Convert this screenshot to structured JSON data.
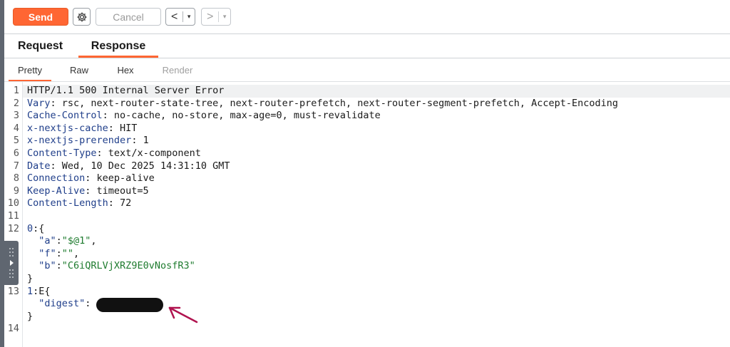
{
  "toolbar": {
    "send_label": "Send",
    "settings_icon": "gear-icon",
    "cancel_label": "Cancel",
    "back_label": "<",
    "back_dropdown": "▾",
    "forward_label": ">",
    "forward_dropdown": "▾"
  },
  "tabs": [
    {
      "label": "Request",
      "selected": false
    },
    {
      "label": "Response",
      "selected": true
    }
  ],
  "subtabs": [
    {
      "label": "Pretty",
      "selected": true
    },
    {
      "label": "Raw",
      "selected": false
    },
    {
      "label": "Hex",
      "selected": false
    },
    {
      "label": "Render",
      "selected": false,
      "disabled": true
    }
  ],
  "editor": {
    "lines": [
      {
        "num": "1",
        "segments": [
          [
            "HTTP/1.1 500 Internal Server Error",
            "v"
          ]
        ]
      },
      {
        "num": "2",
        "segments": [
          [
            "Vary",
            "k"
          ],
          [
            ": rsc, next-router-state-tree, next-router-prefetch, next-router-segment-prefetch, Accept-Encoding",
            "v"
          ]
        ]
      },
      {
        "num": "3",
        "segments": [
          [
            "Cache-Control",
            "k"
          ],
          [
            ": no-cache, no-store, max-age=0, must-revalidate",
            "v"
          ]
        ]
      },
      {
        "num": "4",
        "segments": [
          [
            "x-nextjs-cache",
            "k"
          ],
          [
            ": HIT",
            "v"
          ]
        ]
      },
      {
        "num": "5",
        "segments": [
          [
            "x-nextjs-prerender",
            "k"
          ],
          [
            ": 1",
            "v"
          ]
        ]
      },
      {
        "num": "6",
        "segments": [
          [
            "Content-Type",
            "k"
          ],
          [
            ": text/x-component",
            "v"
          ]
        ]
      },
      {
        "num": "7",
        "segments": [
          [
            "Date",
            "k"
          ],
          [
            ": Wed, 10 Dec 2025 14:31:10 GMT",
            "v"
          ]
        ]
      },
      {
        "num": "8",
        "segments": [
          [
            "Connection",
            "k"
          ],
          [
            ": keep-alive",
            "v"
          ]
        ]
      },
      {
        "num": "9",
        "segments": [
          [
            "Keep-Alive",
            "k"
          ],
          [
            ": timeout=5",
            "v"
          ]
        ]
      },
      {
        "num": "10",
        "segments": [
          [
            "Content-Length",
            "k"
          ],
          [
            ": 72",
            "v"
          ]
        ]
      },
      {
        "num": "11",
        "segments": []
      },
      {
        "num": "12",
        "segments": [
          [
            "0",
            "k"
          ],
          [
            ":{",
            "v"
          ]
        ]
      },
      {
        "num": "",
        "segments": [
          [
            "  \"a\"",
            "sq"
          ],
          [
            ":",
            "v"
          ],
          [
            "\"$@1\"",
            "s"
          ],
          [
            ",",
            "v"
          ]
        ]
      },
      {
        "num": "",
        "segments": [
          [
            "  \"f\"",
            "sq"
          ],
          [
            ":",
            "v"
          ],
          [
            "\"\"",
            "s"
          ],
          [
            ",",
            "v"
          ]
        ]
      },
      {
        "num": "",
        "segments": [
          [
            "  \"b\"",
            "sq"
          ],
          [
            ":",
            "v"
          ],
          [
            "\"C6iQRLVjXRZ9E0vNosfR3\"",
            "s"
          ]
        ]
      },
      {
        "num": "",
        "segments": [
          [
            "}",
            "v"
          ]
        ]
      },
      {
        "num": "13",
        "segments": [
          [
            "1",
            "k"
          ],
          [
            ":E{",
            "v"
          ]
        ]
      },
      {
        "num": "",
        "segments": [
          [
            "  \"digest\"",
            "sq"
          ],
          [
            ":",
            "v"
          ]
        ]
      },
      {
        "num": "",
        "segments": [
          [
            "}",
            "v"
          ]
        ]
      },
      {
        "num": "14",
        "segments": []
      }
    ]
  },
  "annotation": {
    "arrow_color": "#b0134f"
  },
  "colors": {
    "accent": "#ff6633",
    "key": "#1f3e8a",
    "string": "#1e7b2e"
  }
}
